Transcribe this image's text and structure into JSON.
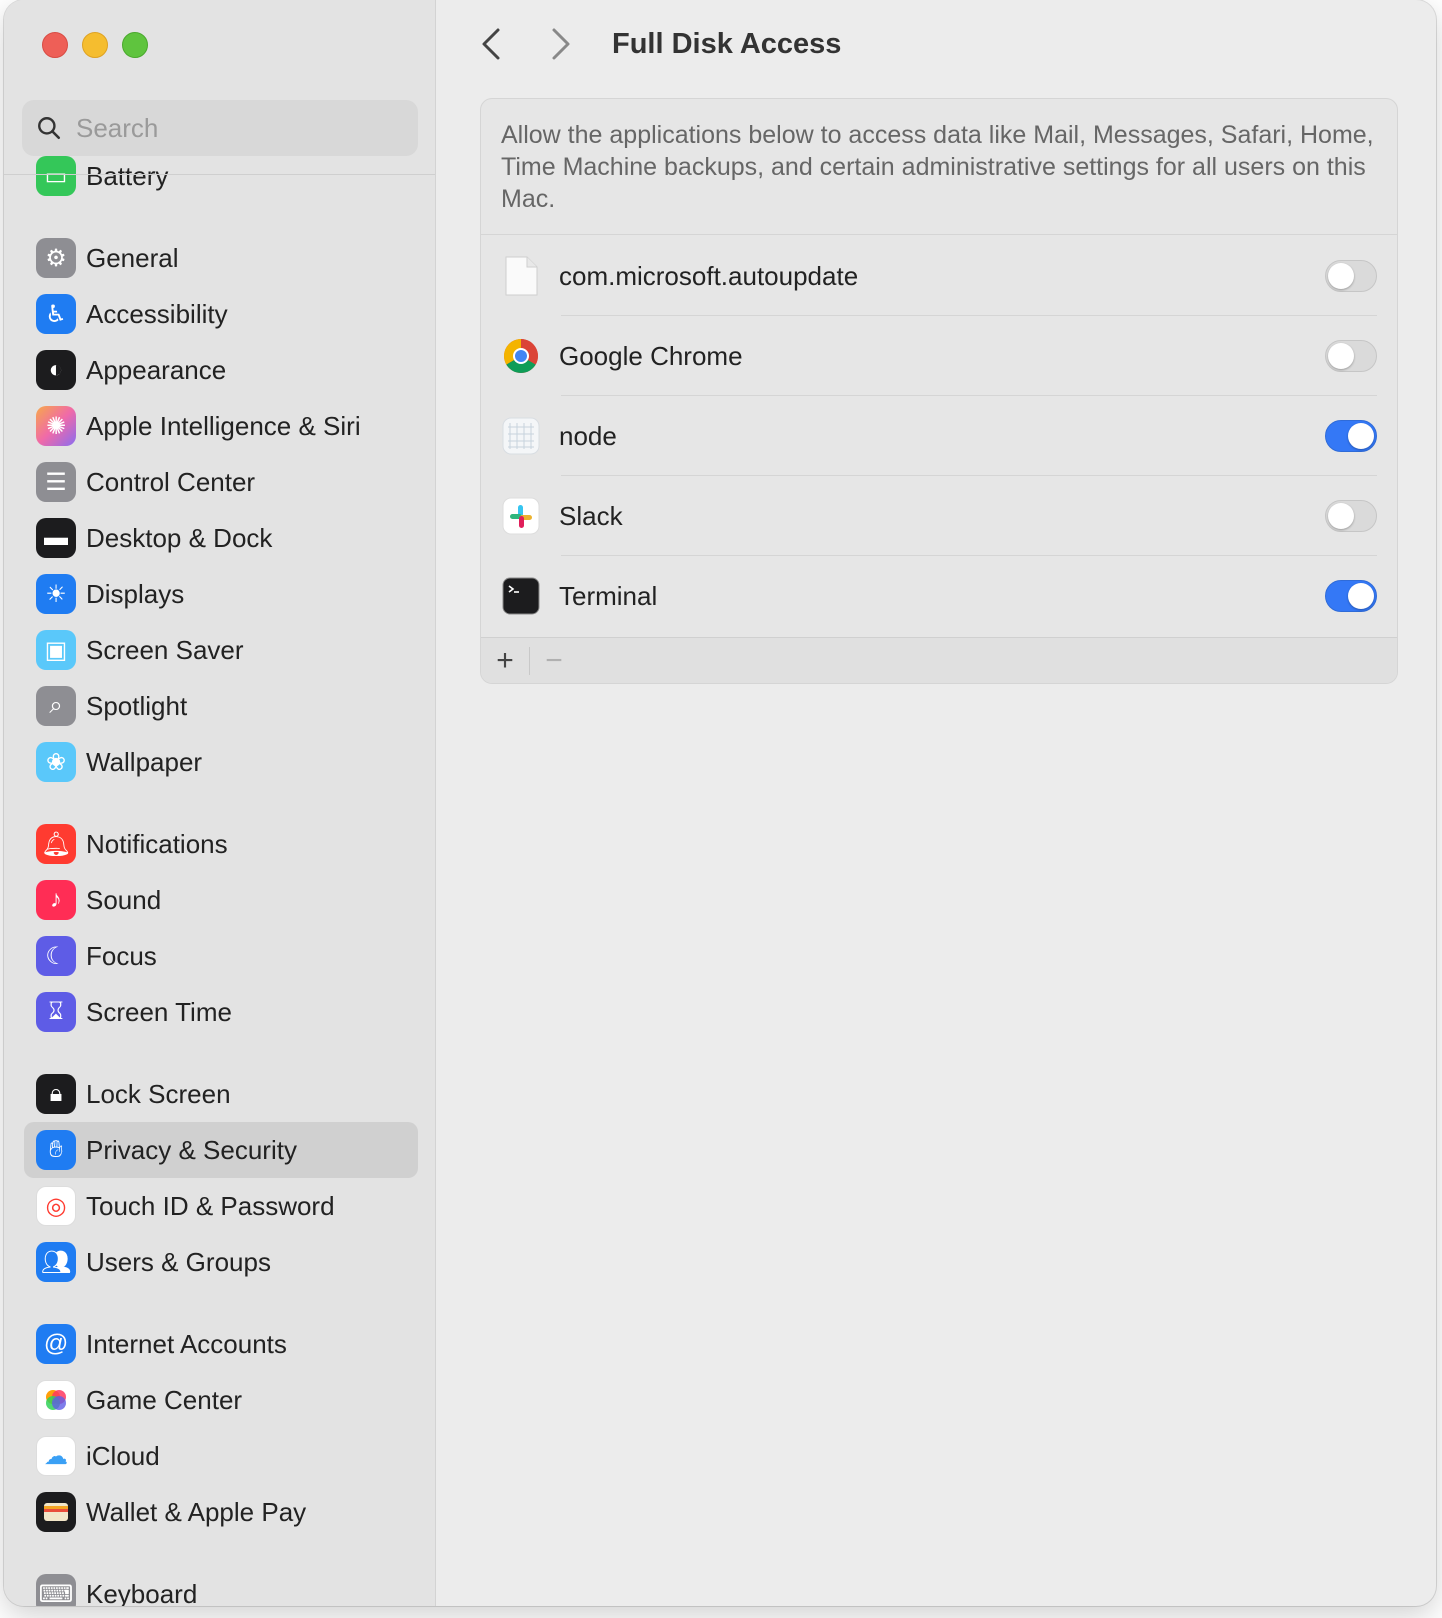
{
  "window": {
    "title": "Full Disk Access"
  },
  "search": {
    "placeholder": "Search"
  },
  "sidebar": {
    "items": [
      {
        "label": "Battery",
        "icon": "battery-icon",
        "color": "#34c759"
      },
      {
        "label": "General",
        "icon": "gear-icon",
        "color": "#8e8e93"
      },
      {
        "label": "Accessibility",
        "icon": "accessibility-icon",
        "color": "#1f7cf2"
      },
      {
        "label": "Appearance",
        "icon": "appearance-icon",
        "color": "#1c1c1e"
      },
      {
        "label": "Apple Intelligence & Siri",
        "icon": "siri-icon",
        "color": "#f07ab0"
      },
      {
        "label": "Control Center",
        "icon": "control-center-icon",
        "color": "#8e8e93"
      },
      {
        "label": "Desktop & Dock",
        "icon": "dock-icon",
        "color": "#1c1c1e"
      },
      {
        "label": "Displays",
        "icon": "sun-icon",
        "color": "#1f7cf2"
      },
      {
        "label": "Screen Saver",
        "icon": "screen-saver-icon",
        "color": "#5ac8fa"
      },
      {
        "label": "Spotlight",
        "icon": "magnifier-icon",
        "color": "#8e8e93"
      },
      {
        "label": "Wallpaper",
        "icon": "flower-icon",
        "color": "#5ac8fa"
      },
      {
        "label": "Notifications",
        "icon": "bell-icon",
        "color": "#ff3b30"
      },
      {
        "label": "Sound",
        "icon": "speaker-icon",
        "color": "#ff2d55"
      },
      {
        "label": "Focus",
        "icon": "moon-icon",
        "color": "#5e5ce6"
      },
      {
        "label": "Screen Time",
        "icon": "hourglass-icon",
        "color": "#5e5ce6"
      },
      {
        "label": "Lock Screen",
        "icon": "lock-icon",
        "color": "#1c1c1e"
      },
      {
        "label": "Privacy & Security",
        "icon": "hand-icon",
        "color": "#1f7cf2"
      },
      {
        "label": "Touch ID & Password",
        "icon": "fingerprint-icon",
        "color": "#ffffff"
      },
      {
        "label": "Users & Groups",
        "icon": "users-icon",
        "color": "#1f7cf2"
      },
      {
        "label": "Internet Accounts",
        "icon": "at-icon",
        "color": "#1f7cf2"
      },
      {
        "label": "Game Center",
        "icon": "game-center-icon",
        "color": "#ffffff"
      },
      {
        "label": "iCloud",
        "icon": "cloud-icon",
        "color": "#ffffff"
      },
      {
        "label": "Wallet & Apple Pay",
        "icon": "wallet-icon",
        "color": "#1c1c1e"
      },
      {
        "label": "Keyboard",
        "icon": "keyboard-icon",
        "color": "#8e8e93"
      }
    ],
    "selected": "Privacy & Security"
  },
  "main": {
    "description": "Allow the applications below to access data like Mail, Messages, Safari, Home, Time Machine backups, and certain administrative settings for all users on this Mac.",
    "apps": [
      {
        "name": "com.microsoft.autoupdate",
        "icon": "document-icon",
        "enabled": false
      },
      {
        "name": "Google Chrome",
        "icon": "chrome-icon",
        "enabled": false
      },
      {
        "name": "node",
        "icon": "node-icon",
        "enabled": true
      },
      {
        "name": "Slack",
        "icon": "slack-icon",
        "enabled": false
      },
      {
        "name": "Terminal",
        "icon": "terminal-icon",
        "enabled": true
      }
    ],
    "add_label": "+",
    "remove_label": "−"
  },
  "colors": {
    "accent": "#3478f6"
  }
}
